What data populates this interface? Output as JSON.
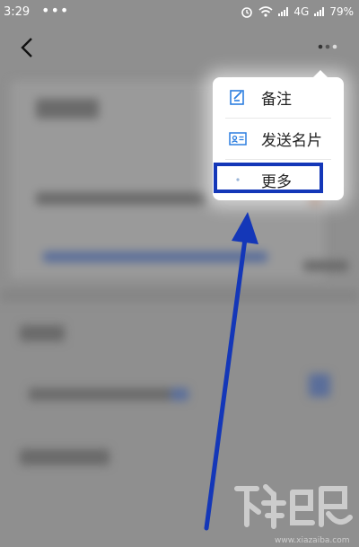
{
  "status_bar": {
    "time": "3:29",
    "dots": "•••",
    "network": "4G",
    "battery": "79%"
  },
  "menu": {
    "items": [
      {
        "label": "备注",
        "icon": "note-edit-icon"
      },
      {
        "label": "发送名片",
        "icon": "contact-card-icon"
      },
      {
        "label": "更多",
        "icon": "more-dot-icon"
      }
    ]
  },
  "colors": {
    "highlight": "#1437b8",
    "arrow": "#1437b8",
    "overlay": "#8f8f8f",
    "menu_icon": "#2d7fe0"
  }
}
